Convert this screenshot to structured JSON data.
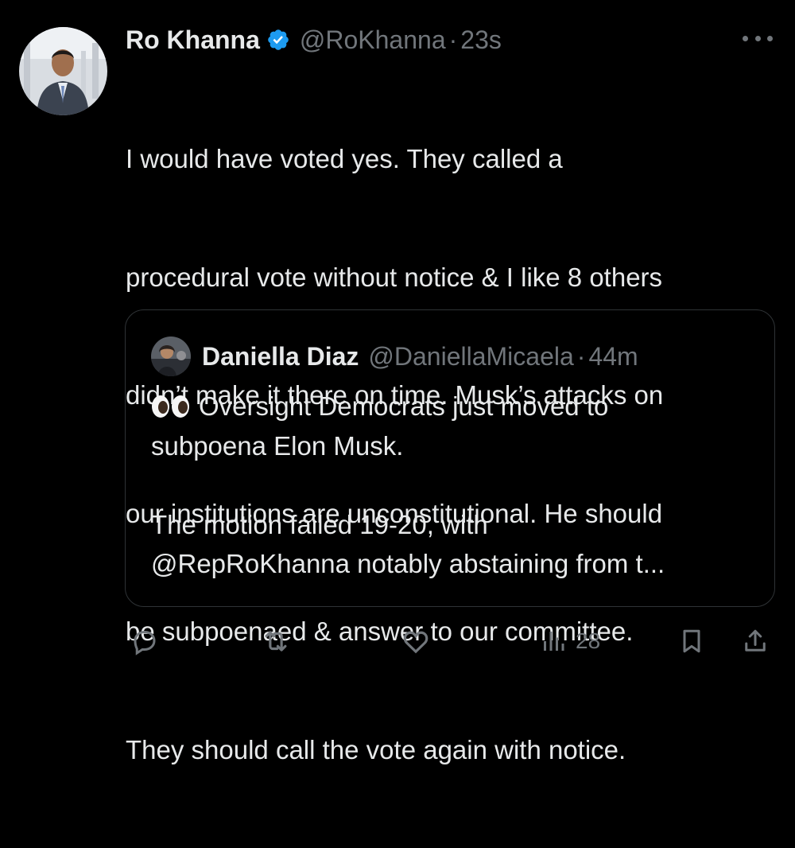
{
  "tweet": {
    "display_name": "Ro Khanna",
    "handle": "@RoKhanna",
    "separator": "·",
    "time": "23s",
    "body_lines": [
      "I would have voted yes. They called a",
      "procedural vote without notice & I like 8 others",
      "didn’t make it there on time. Musk’s attacks on",
      "our institutions are unconstitutional. He should",
      "be subpoenaed & answer to our committee.",
      "They should call the vote again with notice."
    ]
  },
  "quote": {
    "display_name": "Daniella Diaz",
    "handle": "@DaniellaMicaela",
    "separator": "·",
    "time": "44m",
    "line1": "Oversight Democrats just moved to",
    "line2": "subpoena Elon Musk.",
    "line3": "The motion failed 19-20, with",
    "line4": "@RepRoKhanna notably abstaining from t..."
  },
  "actions": {
    "views_count": "28"
  },
  "icons": {
    "verified": "verified-badge-icon",
    "more": "more-icon",
    "reply": "reply-icon",
    "retweet": "retweet-icon",
    "like": "like-icon",
    "views": "views-icon",
    "bookmark": "bookmark-icon",
    "share": "share-icon",
    "eyes": "eyes-emoji-icon"
  },
  "colors": {
    "background": "#000000",
    "text": "#e7e9ea",
    "secondary": "#71767b",
    "verified": "#1d9bf0",
    "border": "#2f3336"
  }
}
